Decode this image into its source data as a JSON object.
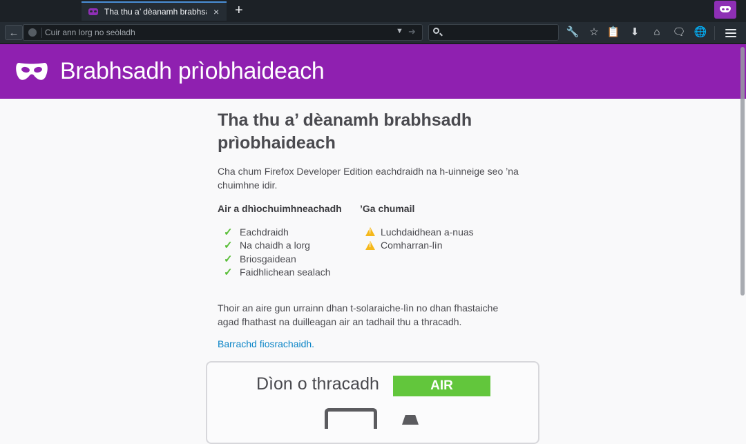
{
  "browser": {
    "tab_title": "Tha thu a’ dèanamh brabhsadh prìobhaideach",
    "tab_close": "×",
    "new_tab": "+",
    "url_placeholder": "Cuir ann lorg no seòladh",
    "search_value": "",
    "toolbar_icons": [
      "wrench-icon",
      "star-icon",
      "clipboard-icon",
      "download-icon",
      "home-icon",
      "chat-icon",
      "globe-icon",
      "hamburger-menu-icon"
    ]
  },
  "header": {
    "title": "Brabhsadh prìobhaideach"
  },
  "content": {
    "heading": "Tha thu a’ dèanamh brabhsadh prìobhaideach",
    "lead": "Cha chum Firefox Developer Edition eachdraidh na h-uinneige seo ’na chuimhne idir.",
    "forgotten_header": "Air a dhìochuimhneachadh",
    "forgotten_items": [
      "Eachdraidh",
      "Na chaidh a lorg",
      "Briosgaidean",
      "Faidhlichean sealach"
    ],
    "kept_header": "’Ga chumail",
    "kept_items": [
      "Luchdaidhean a-nuas",
      "Comharran-lìn"
    ],
    "note": "Thoir an aire gun urrainn dhan t-solaraiche-lìn no dhan fhastaiche agad fhathast na duilleagan air an tadhail thu a thracadh.",
    "learn_more": "Barrachd fiosrachaidh."
  },
  "tracking": {
    "label": "Dìon o thracadh",
    "toggle_state": "AIR"
  },
  "colors": {
    "private_purple": "#8f20b0",
    "toggle_green": "#62c63c",
    "check_green": "#57bd35",
    "warning_yellow": "#f5b81b",
    "link_blue": "#0a84c6"
  }
}
